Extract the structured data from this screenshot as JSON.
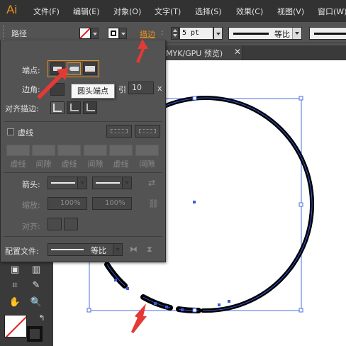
{
  "app": {
    "logo": "Ai"
  },
  "menubar": {
    "items": [
      "文件(F)",
      "编辑(E)",
      "对象(O)",
      "文字(T)",
      "选择(S)",
      "效果(C)",
      "视图(V)",
      "窗口(W)"
    ]
  },
  "controlbar": {
    "left_label": "路径",
    "stroke_label": "描边",
    "stroke_weight": "5 pt",
    "profile_label": "等比"
  },
  "document": {
    "tab_title_fragment": "MYK/GPU 预览)"
  },
  "stroke_panel": {
    "cap_label": "端点",
    "corner_label": "边角",
    "limit_label_fragment": "引",
    "limit_value": "10",
    "limit_suffix": "x",
    "align_label": "对齐描边",
    "dashed_label": "虚线",
    "dash_labels": [
      "虚线",
      "间隙",
      "虚线",
      "间隙",
      "虚线",
      "间隙"
    ],
    "arrows_label": "箭头",
    "scale_label": "缩放",
    "scale_start": "100%",
    "scale_end": "100%",
    "align_arrow_label": "对齐",
    "profile_section_label": "配置文件",
    "profile_value": "等比"
  },
  "tooltip": "圆头端点",
  "colors": {
    "accent": "#e8901f",
    "selection": "#3b5bdb",
    "arrow": "#e53935",
    "panel_bg": "#535353",
    "menubar_bg": "#323232"
  }
}
